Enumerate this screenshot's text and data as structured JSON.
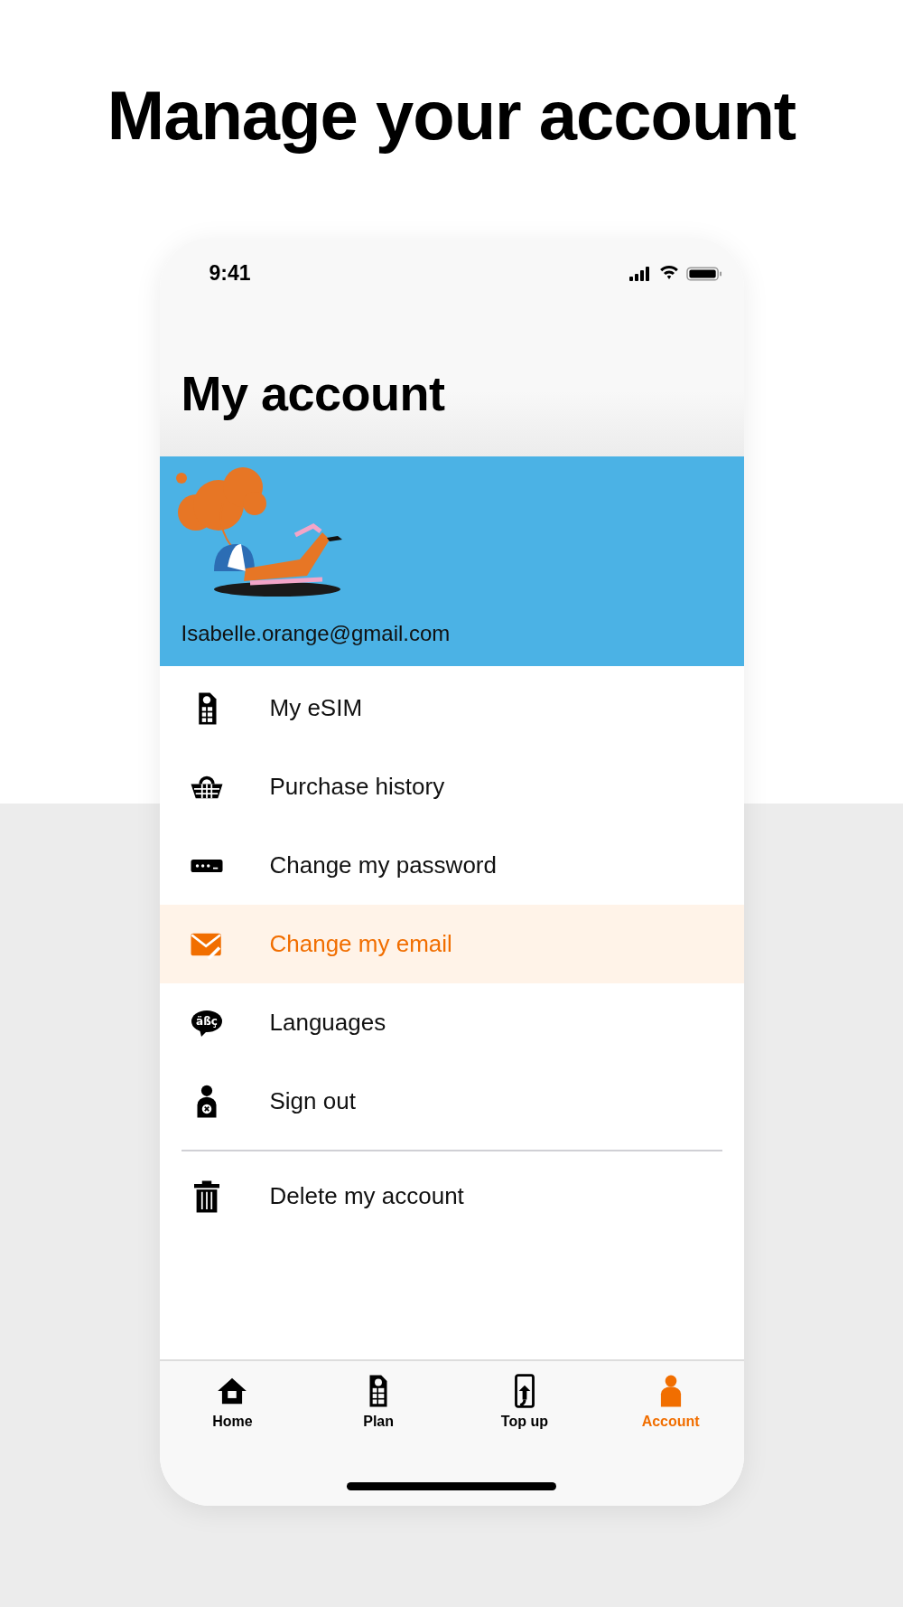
{
  "headline": "Manage your account",
  "status_bar": {
    "time": "9:41"
  },
  "title": "My account",
  "profile": {
    "email": "Isabelle.orange@gmail.com"
  },
  "menu": [
    {
      "kind": "esim",
      "label": "My eSIM",
      "selected": false
    },
    {
      "kind": "basket",
      "label": "Purchase history",
      "selected": false
    },
    {
      "kind": "password",
      "label": "Change my password",
      "selected": false
    },
    {
      "kind": "email",
      "label": "Change my email",
      "selected": true
    },
    {
      "kind": "languages",
      "label": "Languages",
      "selected": false,
      "icon_text": "äßç"
    },
    {
      "kind": "signout",
      "label": "Sign out",
      "selected": false
    },
    {
      "kind": "divider"
    },
    {
      "kind": "delete",
      "label": "Delete my account",
      "selected": false
    }
  ],
  "tabs": [
    {
      "kind": "home",
      "label": "Home",
      "selected": false
    },
    {
      "kind": "plan",
      "label": "Plan",
      "selected": false
    },
    {
      "kind": "topup",
      "label": "Top up",
      "selected": false
    },
    {
      "kind": "account",
      "label": "Account",
      "selected": true
    }
  ]
}
